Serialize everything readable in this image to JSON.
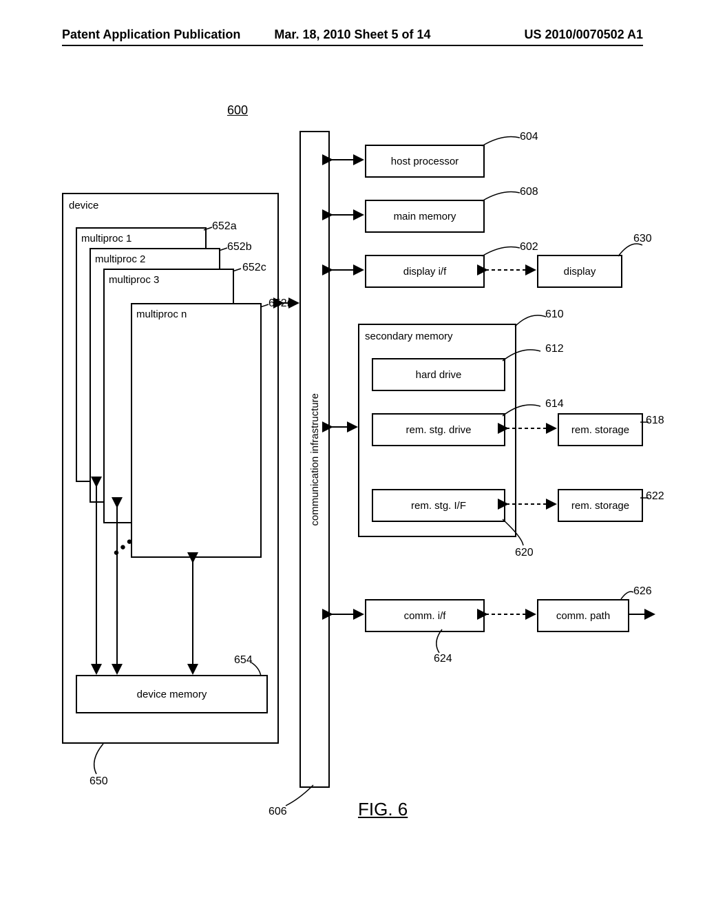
{
  "header": {
    "left": "Patent Application Publication",
    "center": "Mar. 18, 2010  Sheet 5 of 14",
    "right": "US 2010/0070502 A1"
  },
  "ref": {
    "overall": "600"
  },
  "right": {
    "host": {
      "label": "host processor",
      "num": "604"
    },
    "main": {
      "label": "main memory",
      "num": "608"
    },
    "dispif": {
      "label": "display i/f",
      "num": "602"
    },
    "disp": {
      "label": "display",
      "num": "630"
    },
    "sec": {
      "label": "secondary memory",
      "num": "610"
    },
    "hdd": {
      "label": "hard drive",
      "num": "612"
    },
    "rsd": {
      "label": "rem. stg. drive",
      "num": "614"
    },
    "rsf": {
      "label": "rem. stg. I/F",
      "num": "620"
    },
    "rs1": {
      "label": "rem. storage",
      "num": "618"
    },
    "rs2": {
      "label": "rem. storage",
      "num": "622"
    },
    "cif": {
      "label": "comm. i/f",
      "num": "624"
    },
    "cp": {
      "label": "comm. path",
      "num": "626"
    }
  },
  "bus": {
    "label": "communication infrastructure",
    "num": "606"
  },
  "left": {
    "device": {
      "label": "device",
      "num": "650"
    },
    "mp1": {
      "label": "multiproc 1",
      "num": "652a"
    },
    "mp2": {
      "label": "multiproc 2",
      "num": "652b"
    },
    "mp3": {
      "label": "multiproc 3",
      "num": "652c"
    },
    "mpn": {
      "label": "multiproc n",
      "num": "652n"
    },
    "dmem": {
      "label": "device memory",
      "num": "654"
    }
  },
  "figure_caption": "FIG. 6"
}
